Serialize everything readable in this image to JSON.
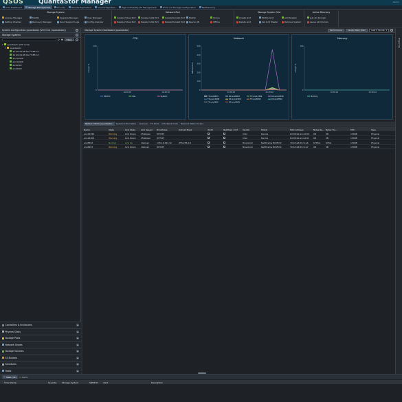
{
  "app": {
    "logo": "QSOS",
    "title": "QuantaStor Manager",
    "user": "admin"
  },
  "nav_tabs": [
    {
      "label": "User Dashboard",
      "active": false
    },
    {
      "label": "Storage Management",
      "active": true
    },
    {
      "label": "Security",
      "active": false
    },
    {
      "label": "Remote Replication",
      "active": false
    },
    {
      "label": "Cloud Integration",
      "active": false
    },
    {
      "label": "High-availability VIF Management",
      "active": false
    },
    {
      "label": "Scale-out Storage Configuration",
      "active": false
    },
    {
      "label": "Multitenancy",
      "active": false
    }
  ],
  "ribbon": {
    "storage_system": {
      "title": "Storage System",
      "buttons": [
        "License Manager",
        "Modify",
        "Upgrade Manager",
        "User Manager",
        "Setting Checker",
        "Recovery Manager",
        "Send Support Logs",
        "Config Analyzer"
      ]
    },
    "network_port": {
      "title": "Network Port",
      "buttons": [
        "Create Virtual Port",
        "Create VLAN Port",
        "Create Bonded Port",
        "Modify",
        "Online",
        "Delete Virtual Port",
        "Delete VLAN Port",
        "Delete Bonded Port",
        "Rescan IB",
        "Offline"
      ]
    },
    "storage_system_grid": {
      "title": "Storage System Grid",
      "buttons": [
        "Create Grid",
        "Modify Grid",
        "Add System",
        "Delete Grid",
        "Set Grid Master",
        "Remove System"
      ]
    },
    "active_directory": {
      "title": "Active Directory",
      "buttons": [
        "Join AD Domain",
        "Leave AD Domain"
      ]
    }
  },
  "left_panel": {
    "title": "System Configuration (quantastor (VIO Grid / quantastor))",
    "section": "Storage Systems",
    "filter_label": "Filters",
    "tree": [
      {
        "label": "quantastor (VIO Grid)",
        "level": 0,
        "kind": "grid"
      },
      {
        "label": "quantastor",
        "level": 1,
        "kind": "system"
      },
      {
        "label": "21:00:24:0E:0A:77:8E:C2",
        "level": 2,
        "kind": "port"
      },
      {
        "label": "21:00:24:0E:0A:77:8E:C3",
        "level": 2,
        "kind": "port"
      },
      {
        "label": "eno12399",
        "level": 2,
        "kind": "port"
      },
      {
        "label": "eno12409",
        "level": 2,
        "kind": "port"
      },
      {
        "label": "enx8302",
        "level": 2,
        "kind": "port"
      },
      {
        "label": "enx8403",
        "level": 2,
        "kind": "port"
      }
    ],
    "accordion": [
      {
        "label": "Controllers & Enclosures",
        "icon": "controller-icon"
      },
      {
        "label": "Physical Disks",
        "icon": "disk-icon"
      },
      {
        "label": "Storage Pools",
        "icon": "pool-icon"
      },
      {
        "label": "Network Shares",
        "icon": "share-icon"
      },
      {
        "label": "Storage Volumes",
        "icon": "volume-icon"
      },
      {
        "label": "S3 Buckets",
        "icon": "bucket-icon"
      },
      {
        "label": "Schedules",
        "icon": "schedule-icon"
      },
      {
        "label": "Hosts",
        "icon": "host-icon"
      }
    ]
  },
  "dashboard": {
    "title": "Storage System Dashboard (quantastor)",
    "performance_button": "Performance",
    "cluster_stats_button": "Cluster Stats (SSC)",
    "range_select": "Last 1 minute"
  },
  "chart_data": [
    {
      "type": "line",
      "title": "CPU",
      "ylabel": "Usage %",
      "x": [
        "16:30:20",
        "16:30:40"
      ],
      "ylim": [
        0,
        100
      ],
      "series": [
        {
          "name": "Wait IO",
          "values": [
            0,
            0,
            0,
            0,
            0,
            0,
            0,
            0,
            0,
            0,
            0,
            0
          ]
        },
        {
          "name": "Idle",
          "values": [
            0,
            0,
            0,
            0,
            0,
            0,
            0,
            0,
            0,
            0,
            0,
            0
          ]
        },
        {
          "name": "System",
          "values": [
            0,
            0,
            0,
            0,
            0,
            0,
            0,
            0,
            0,
            0,
            0,
            0
          ]
        }
      ]
    },
    {
      "type": "line",
      "title": "Network",
      "ylabel": "MB/second",
      "x": [
        "16:30:20",
        "16:30:40"
      ],
      "ylim": [
        0,
        500
      ],
      "y_ticks": [
        0,
        100,
        200,
        300,
        400,
        500
      ],
      "series": [
        {
          "name": "TX:enx8403",
          "values": [
            0,
            0,
            0,
            0,
            0,
            0,
            0,
            0,
            0,
            0,
            10,
            0,
            0
          ]
        },
        {
          "name": "RX:enx8403",
          "values": [
            0,
            0,
            0,
            0,
            0,
            0,
            0,
            0,
            0,
            0,
            15,
            0,
            0
          ]
        },
        {
          "name": "TX:eno12399",
          "values": [
            0,
            0,
            0,
            0,
            0,
            0,
            0,
            0,
            0,
            0,
            30,
            0,
            0
          ]
        },
        {
          "name": "RX:eno12399",
          "values": [
            0,
            0,
            0,
            0,
            0,
            0,
            0,
            0,
            0,
            0,
            460,
            0,
            0
          ]
        },
        {
          "name": "TX:eno12409",
          "values": [
            0,
            0,
            0,
            0,
            0,
            0,
            0,
            0,
            0,
            0,
            20,
            0,
            0
          ]
        },
        {
          "name": "RX:eno12409",
          "values": [
            0,
            0,
            0,
            0,
            0,
            0,
            0,
            0,
            0,
            0,
            25,
            0,
            0
          ]
        },
        {
          "name": "TX:enx8302",
          "values": [
            0,
            0,
            0,
            0,
            0,
            0,
            0,
            0,
            0,
            0,
            5,
            0,
            0
          ]
        },
        {
          "name": "RX:enx8302",
          "values": [
            0,
            0,
            0,
            0,
            0,
            0,
            0,
            0,
            0,
            0,
            8,
            0,
            0
          ]
        },
        {
          "name": "TX:eno0002",
          "values": [
            0,
            0,
            0,
            0,
            0,
            0,
            0,
            0,
            0,
            0,
            4,
            0,
            0
          ]
        },
        {
          "name": "RX:eno0002",
          "values": [
            0,
            0,
            0,
            0,
            0,
            0,
            0,
            0,
            0,
            0,
            6,
            0,
            0
          ]
        }
      ]
    },
    {
      "type": "line",
      "title": "Memory",
      "ylabel": "Usage %",
      "x": [
        "16:30:20",
        "16:30:40"
      ],
      "ylim": [
        0,
        100
      ],
      "series": [
        {
          "name": "Memory",
          "values": [
            0,
            0,
            0,
            0,
            0,
            0,
            0,
            0,
            0,
            0,
            0,
            0
          ]
        }
      ]
    }
  ],
  "detail_tabs": [
    {
      "label": "Network Ports (quantastor)",
      "active": true
    },
    {
      "label": "System Information",
      "active": false
    },
    {
      "label": "Licenses",
      "active": false
    },
    {
      "label": "FC Ports",
      "active": false
    },
    {
      "label": "Infiniband Ports",
      "active": false
    },
    {
      "label": "Network Static Routes",
      "active": false
    }
  ],
  "ports_table": {
    "columns": [
      "Name",
      "State",
      "Link State",
      "Link Speed",
      "IP Address",
      "Subnet Mask",
      "iSCSI",
      "NetMask / VLT",
      "Vendor",
      "Model",
      "MAC Address",
      "Bytes Re...",
      "Bytes Tra...",
      "MTU",
      "Type"
    ],
    "rows": [
      [
        "eno12399",
        "Warning",
        "Link Down",
        "25Gb/sec",
        "[DHCP]",
        "",
        "",
        "",
        "Intel",
        "Device",
        "b4:96:91:a4:ad:90",
        "0B",
        "0B",
        "1500B",
        "Physical"
      ],
      [
        "eno12409",
        "Warning",
        "Link Down",
        "25Gb/sec",
        "[DHCP]",
        "",
        "",
        "",
        "Intel",
        "Device",
        "b4:96:91:a4:ad:91",
        "0B",
        "0B",
        "1500B",
        "Physical"
      ],
      [
        "enx8302",
        "Normal",
        "Link Up",
        "1Gb/sec",
        "176.16.252.12",
        "255.255.0.0",
        "",
        "",
        "Broadcom",
        "NetXtreme BCM572",
        "70:b5:e8:2f:cb:a6",
        "6765G",
        "676G",
        "1500B",
        "Physical"
      ],
      [
        "enx8403",
        "Warning",
        "Link Down",
        "1Gb/sec",
        "[DHCP]",
        "",
        "",
        "",
        "Broadcom",
        "NetXtreme BCM572",
        "70:b5:e8:2f:cb:a7",
        "0B",
        "0B",
        "1500B",
        "Physical"
      ]
    ]
  },
  "bottom_panel": {
    "tabs": [
      {
        "label": "Tasks (44)",
        "active": true
      },
      {
        "label": "Alerts",
        "active": false
      }
    ],
    "columns": [
      "Time Stamp",
      "Severity",
      "Storage System",
      "SNMP ID",
      "Alert",
      "Description"
    ]
  },
  "colors": {
    "accent": "#9ccb3b",
    "warning": "#e0a84a",
    "normal": "#74c05a",
    "chart_bg": "#10293a"
  }
}
